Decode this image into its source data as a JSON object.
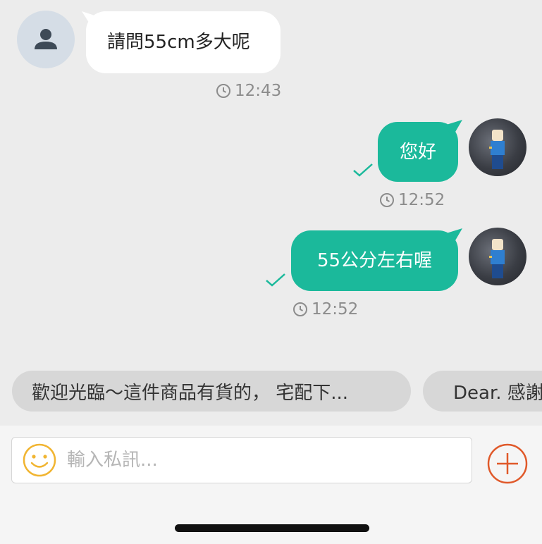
{
  "messages": [
    {
      "direction": "incoming",
      "text": "請問55cm多大呢",
      "time": "12:43"
    },
    {
      "direction": "outgoing",
      "text": "您好",
      "time": "12:52",
      "status": "read"
    },
    {
      "direction": "outgoing",
      "text": "55公分左右喔",
      "time": "12:52",
      "status": "read"
    }
  ],
  "quick_replies": [
    {
      "label": "歡迎光臨～這件商品有貨的， 宅配下..."
    },
    {
      "label": "Dear. 感謝"
    }
  ],
  "composer": {
    "placeholder": "輸入私訊..."
  },
  "colors": {
    "outgoing_bubble": "#1bb99b",
    "incoming_bubble": "#ffffff",
    "accent_plus": "#e0592a",
    "emoji": "#f1b532",
    "background": "#ececec"
  },
  "icons": [
    "person-icon",
    "clock-icon",
    "check-icon",
    "emoji-icon",
    "plus-icon"
  ]
}
